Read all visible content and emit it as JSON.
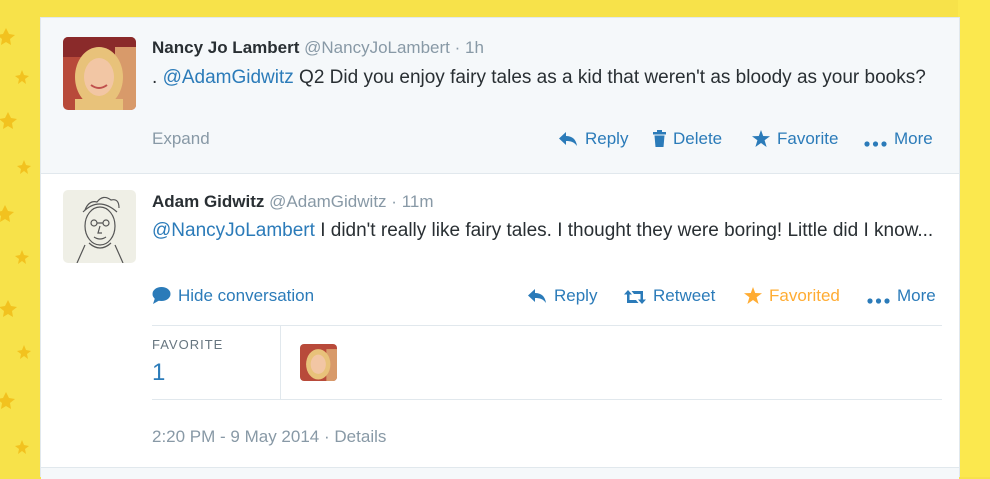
{
  "tweets": [
    {
      "name": "Nancy Jo Lambert",
      "handle": "@NancyJoLambert",
      "separator": "·",
      "time": "1h",
      "text_prefix": ". ",
      "mention": "@AdamGidwitz",
      "text": " Q2 Did you enjoy fairy tales as a kid that weren't as bloody as your books?",
      "expand_label": "Expand",
      "actions": {
        "reply": "Reply",
        "delete": "Delete",
        "favorite": "Favorite",
        "more": "More"
      }
    },
    {
      "name": "Adam Gidwitz",
      "handle": "@AdamGidwitz",
      "separator": "·",
      "time": "11m",
      "mention": "@NancyJoLambert",
      "text": " I didn't really like fairy tales. I thought they were boring! Little did I know...",
      "hide_conversation_label": "Hide conversation",
      "actions": {
        "reply": "Reply",
        "retweet": "Retweet",
        "favorited": "Favorited",
        "more": "More"
      },
      "stats": {
        "favorite_label": "FAVORITE",
        "favorite_count": "1"
      },
      "timestamp": "2:20 PM - 9 May 2014",
      "details_separator": "·",
      "details_label": "Details"
    }
  ],
  "colors": {
    "background": "#f7e24a",
    "link": "#2b7bb9",
    "favorited": "#ffac33",
    "muted": "#8899a6",
    "text": "#292f33"
  },
  "icons": [
    "reply-icon",
    "trash-icon",
    "star-icon",
    "more-dots-icon",
    "speech-bubble-icon",
    "retweet-icon"
  ]
}
